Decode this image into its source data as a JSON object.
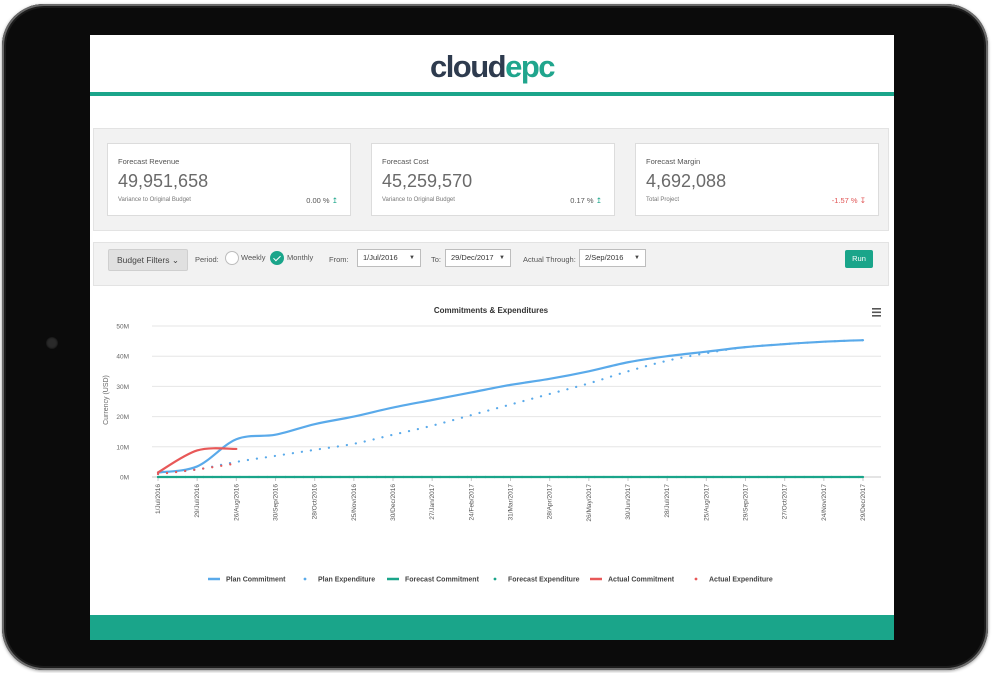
{
  "logo": {
    "part1": "cloud",
    "part2": "epc"
  },
  "colors": {
    "accent": "#1aa58a",
    "negative": "#e05454",
    "plan": "#5aaaea",
    "actual": "#e85858",
    "forecast": "#1aa58a"
  },
  "kpis": [
    {
      "title": "Forecast Revenue",
      "value": "49,951,658",
      "sub": "Variance to Original Budget",
      "change": "0.00 %",
      "trend": "up",
      "arrow": "↥"
    },
    {
      "title": "Forecast Cost",
      "value": "45,259,570",
      "sub": "Variance to Original Budget",
      "change": "0.17 %",
      "trend": "up",
      "arrow": "↥"
    },
    {
      "title": "Forecast Margin",
      "value": "4,692,088",
      "sub": "Total Project",
      "change": "-1.57 %",
      "trend": "down",
      "arrow": "↧"
    }
  ],
  "filters": {
    "budget_label": "Budget Filters",
    "budget_caret": "⌄",
    "period_label": "Period:",
    "weekly": "Weekly",
    "monthly": "Monthly",
    "selected_period": "Monthly",
    "from_label": "From:",
    "from_value": "1/Jul/2016",
    "to_label": "To:",
    "to_value": "29/Dec/2017",
    "through_label": "Actual Through:",
    "through_value": "2/Sep/2016",
    "select_caret": "▼",
    "run": "Run"
  },
  "chart_data": {
    "type": "line",
    "title": "Commitments & Expenditures",
    "ylabel": "Currency (USD)",
    "xlabel": "",
    "ylim": [
      0,
      50
    ],
    "y_ticks": [
      "0M",
      "10M",
      "20M",
      "30M",
      "40M",
      "50M"
    ],
    "x": [
      "1/Jul/2016",
      "29/Jul/2016",
      "26/Aug/2016",
      "30/Sep/2016",
      "28/Oct/2016",
      "25/Nov/2016",
      "30/Dec/2016",
      "27/Jan/2017",
      "24/Feb/2017",
      "31/Mar/2017",
      "28/Apr/2017",
      "26/May/2017",
      "30/Jun/2017",
      "28/Jul/2017",
      "25/Aug/2017",
      "29/Sep/2017",
      "27/Oct/2017",
      "24/Nov/2017",
      "29/Dec/2017"
    ],
    "grid": true,
    "legend_position": "bottom",
    "series": [
      {
        "name": "Plan Commitment",
        "style": "solid",
        "color": "#5aaaea",
        "values": [
          1.5,
          3.5,
          12.5,
          14,
          17.5,
          20,
          23,
          25.5,
          28,
          30.5,
          32.5,
          35,
          38,
          40,
          41.5,
          43,
          44,
          44.8,
          45.3
        ]
      },
      {
        "name": "Plan Expenditure",
        "style": "dotted",
        "color": "#5aaaea",
        "values": [
          1,
          2.5,
          5,
          7,
          9,
          11,
          14,
          17,
          20.5,
          24,
          27.5,
          31,
          35,
          38.5,
          41,
          43,
          44,
          44.8,
          45.3
        ]
      },
      {
        "name": "Forecast Commitment",
        "style": "solid",
        "color": "#1aa58a",
        "values": [
          0,
          0,
          0,
          0,
          0,
          0,
          0,
          0,
          0,
          0,
          0,
          0,
          0,
          0,
          0,
          0,
          0,
          0,
          0
        ]
      },
      {
        "name": "Forecast Expenditure",
        "style": "dotted",
        "color": "#1aa58a",
        "values": [
          0,
          0,
          0,
          0,
          0,
          0,
          0,
          0,
          0,
          0,
          0,
          0,
          0,
          0,
          0,
          0,
          0,
          0,
          0
        ]
      },
      {
        "name": "Actual Commitment",
        "style": "solid",
        "color": "#e85858",
        "values": [
          1.5,
          8.8,
          9.3
        ]
      },
      {
        "name": "Actual Expenditure",
        "style": "dotted",
        "color": "#e85858",
        "values": [
          1,
          2.5,
          4.5
        ]
      }
    ]
  }
}
